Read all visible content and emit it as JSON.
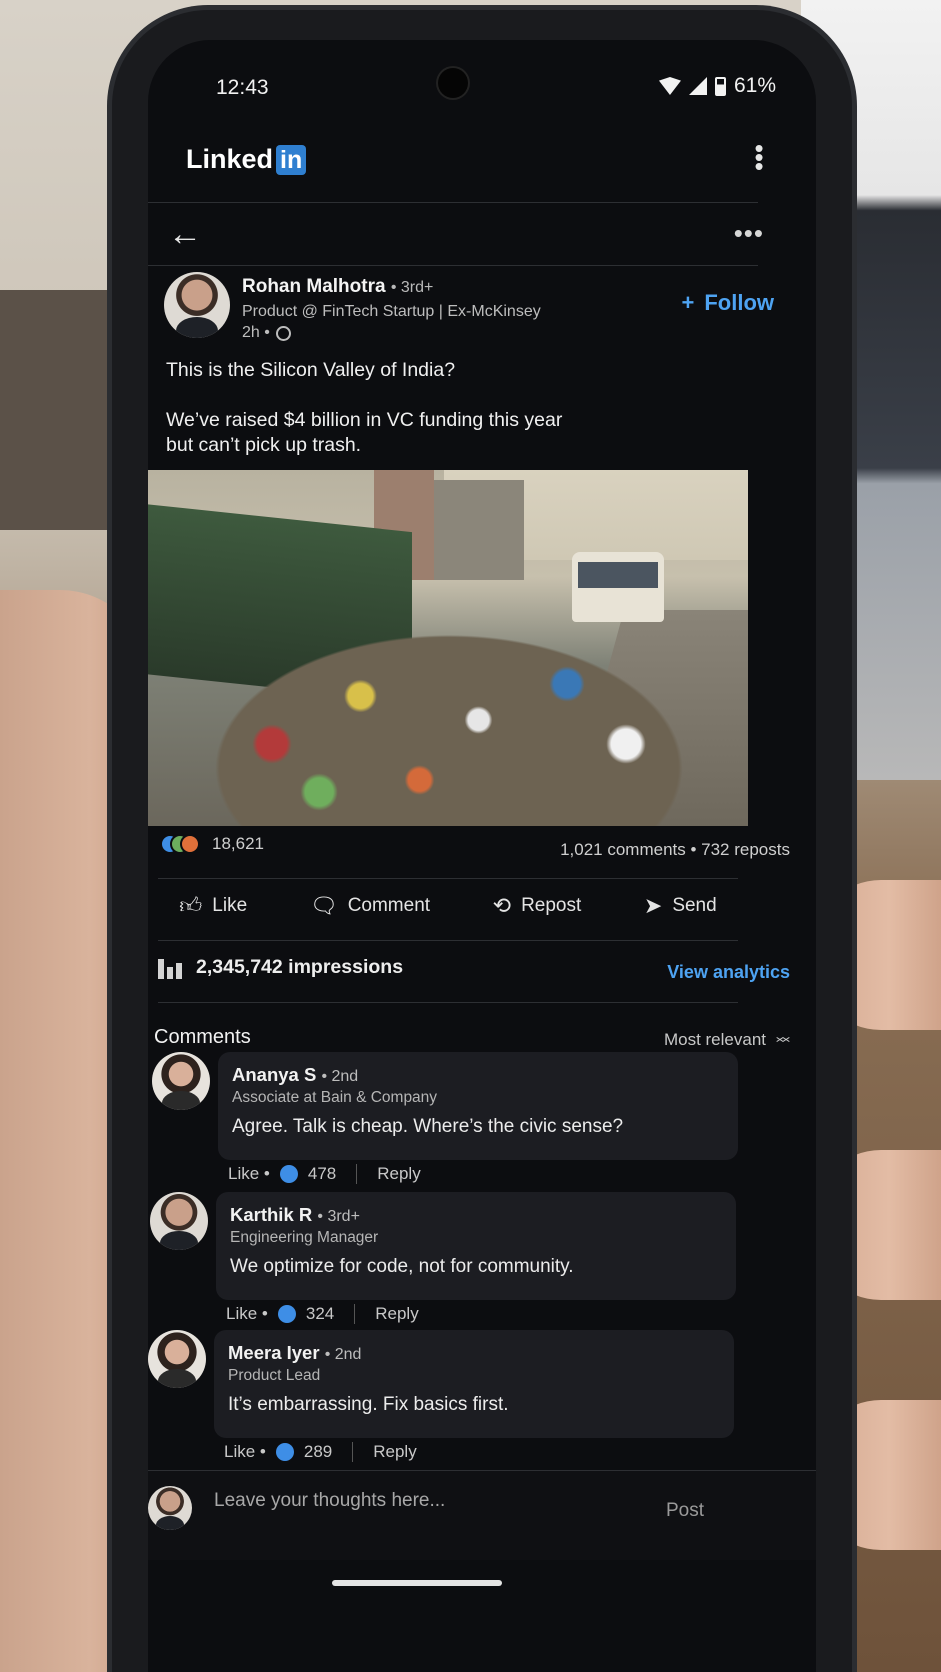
{
  "status_bar": {
    "time": "12:43",
    "battery": "61%"
  },
  "app": {
    "logo_text": "Linked",
    "logo_badge": "in"
  },
  "post": {
    "author": {
      "name": "Rohan Malhotra",
      "degree": "• 3rd+",
      "headline": "Product @ FinTech Startup | Ex-McKinsey",
      "time": "2h •"
    },
    "follow_label": "Follow",
    "text_line1": "This is the Silicon Valley of India?",
    "text_line2": "We’ve raised $4 billion in VC funding this year but can’t pick up trash.",
    "reaction_count": "18,621",
    "stats": "1,021 comments • 732 reposts",
    "actions": {
      "like": "Like",
      "comment": "Comment",
      "repost": "Repost",
      "send": "Send"
    },
    "impressions": "2,345,742 impressions",
    "analytics_label": "View analytics"
  },
  "comments_section": {
    "title": "Comments",
    "sort_label": "Most relevant",
    "items": [
      {
        "name": "Ananya S",
        "degree": "• 2nd",
        "headline": "Associate at Bain & Company",
        "text": "Agree. Talk is cheap. Where’s the civic sense?",
        "like_label": "Like •",
        "likes": "478",
        "reply_label": "Reply"
      },
      {
        "name": "Karthik R",
        "degree": "• 3rd+",
        "headline": "Engineering Manager",
        "text": "We optimize for code, not for community.",
        "like_label": "Like •",
        "likes": "324",
        "reply_label": "Reply"
      },
      {
        "name": "Meera Iyer",
        "degree": "• 2nd",
        "headline": "Product Lead",
        "text": "It’s embarrassing. Fix basics first.",
        "like_label": "Like •",
        "likes": "289",
        "reply_label": "Reply"
      }
    ]
  },
  "composer": {
    "placeholder": "Leave your thoughts here...",
    "post_label": "Post"
  },
  "colors": {
    "accent": "#4ea3f2",
    "background": "#0c0d10",
    "like_blue": "#3e8ee6"
  }
}
